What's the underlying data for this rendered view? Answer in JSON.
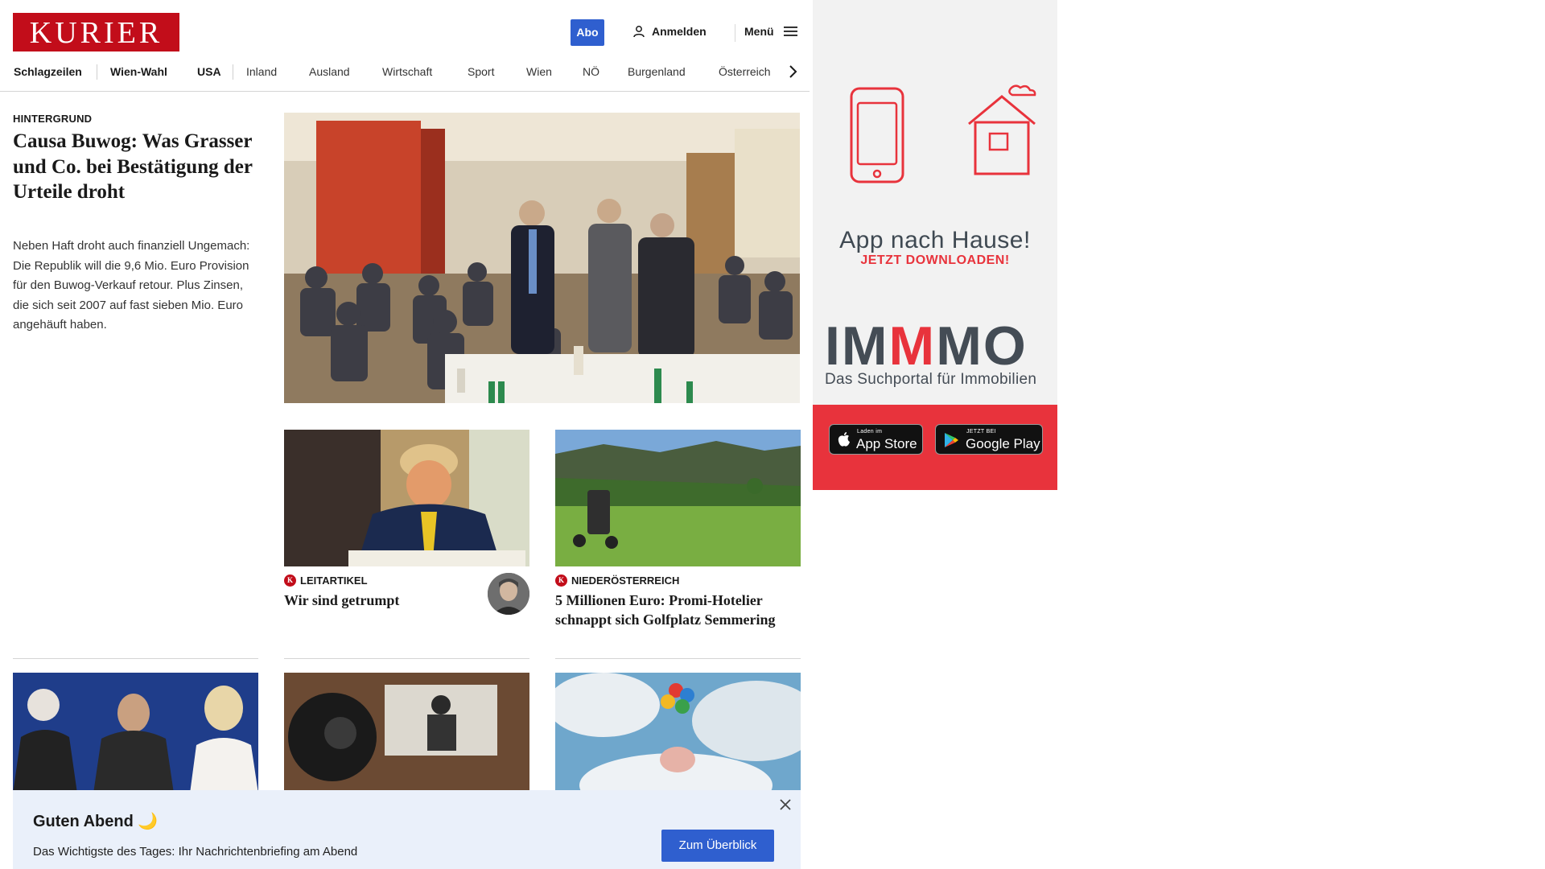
{
  "header": {
    "logo": "KURIER",
    "abo_label": "Abo",
    "login_label": "Anmelden",
    "menu_label": "Menü"
  },
  "nav": {
    "items": [
      "Schlagzeilen",
      "Wien-Wahl",
      "USA",
      "Inland",
      "Ausland",
      "Wirtschaft",
      "Sport",
      "Wien",
      "NÖ",
      "Burgenland",
      "Österreich"
    ]
  },
  "hero": {
    "category": "HINTERGRUND",
    "title": "Causa Buwog: Was Grasser und Co. bei Bestätigung der Urteile droht",
    "teaser": "Neben Haft droht auch finanziell Ungemach: Die Republik will die 9,6 Mio. Euro Provision für den Buwog-Verkauf retour. Plus Zinsen, die sich seit 2007 auf fast sieben Mio. Euro angehäuft haben."
  },
  "cards": [
    {
      "category": "LEITARTIKEL",
      "title": "Wir sind getrumpt"
    },
    {
      "category": "NIEDERÖSTERREICH",
      "title": "5 Millionen Euro: Promi-Hotelier schnappt sich Golfplatz Semmering"
    }
  ],
  "badge_letter": "K",
  "notification": {
    "title": "Guten Abend 🌙",
    "text": "Das Wichtigste des Tages: Ihr Nachrichtenbriefing am Abend",
    "button": "Zum Überblick"
  },
  "ad": {
    "headline": "App nach Hause!",
    "subline": "JETZT DOWNLOADEN!",
    "brand_a": "IM",
    "brand_b": "M",
    "brand_c": "MO",
    "tagline": "Das Suchportal für Immobilien",
    "appstore_small": "Laden im",
    "appstore_big": "App Store",
    "google_small": "JETZT BEI",
    "google_big": "Google Play"
  },
  "colors": {
    "brand_red": "#c20d1a",
    "accent_blue": "#2f5fcf",
    "ad_red": "#e8333c"
  }
}
